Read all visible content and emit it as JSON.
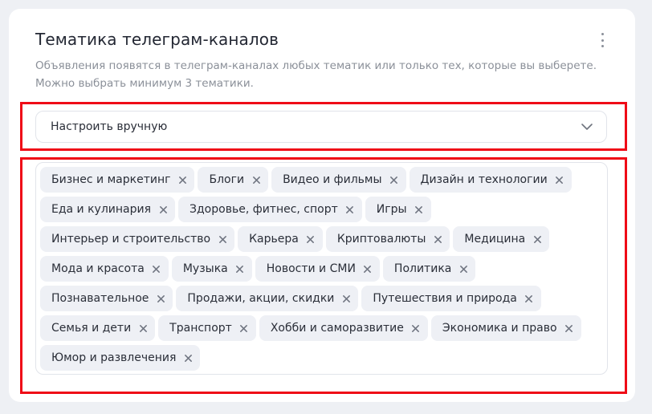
{
  "card": {
    "title": "Тематика телеграм-каналов",
    "description_lines": [
      "Объявления появятся в телеграм-каналах любых тематик или только тех, которые вы выберете.",
      "Можно выбрать минимум 3 тематики."
    ]
  },
  "select": {
    "value": "Настроить вручную",
    "icon": "chevron-down-icon"
  },
  "tags": [
    "Бизнес и маркетинг",
    "Блоги",
    "Видео и фильмы",
    "Дизайн и технологии",
    "Еда и кулинария",
    "Здоровье, фитнес, спорт",
    "Игры",
    "Интерьер и строительство",
    "Карьера",
    "Криптовалюты",
    "Медицина",
    "Мода и красота",
    "Музыка",
    "Новости и СМИ",
    "Политика",
    "Познавательное",
    "Продажи, акции, скидки",
    "Путешествия и природа",
    "Семья и дети",
    "Транспорт",
    "Хобби и саморазвитие",
    "Экономика и право",
    "Юмор и развлечения"
  ],
  "colors": {
    "highlight": "#ef0b17",
    "tag_background": "#eef0f5",
    "page_background": "#eef0f4"
  }
}
